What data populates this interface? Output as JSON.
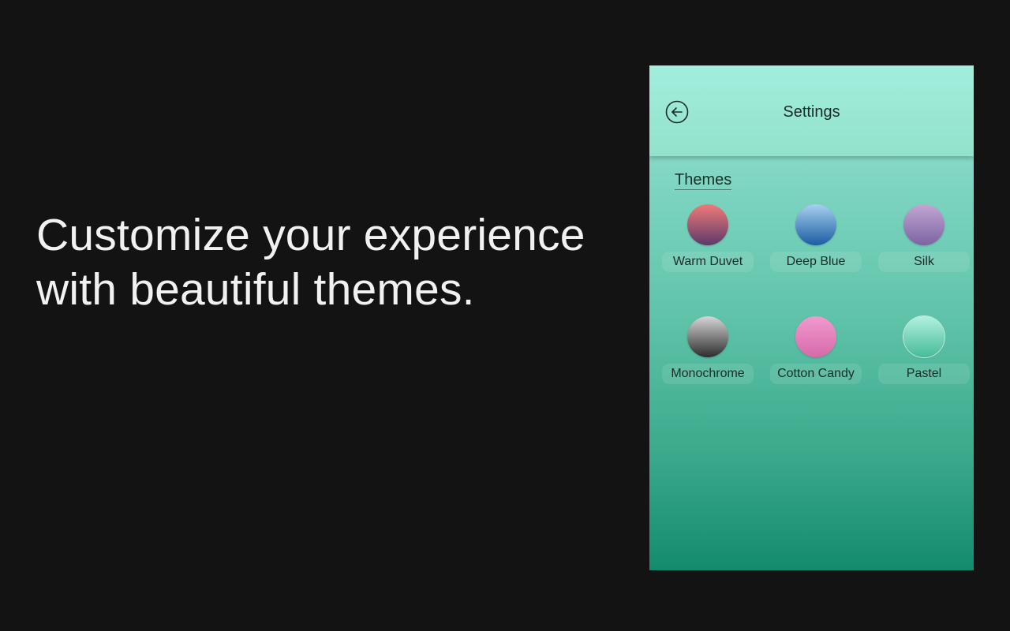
{
  "headline": {
    "line1": "Customize your experience",
    "line2": "with beautiful themes."
  },
  "settings": {
    "title": "Settings",
    "back_icon": "back-arrow-icon",
    "section_label": "Themes",
    "themes": [
      {
        "label": "Warm Duvet",
        "gradient": [
          "#f07a78",
          "#5b3a6b"
        ]
      },
      {
        "label": "Deep Blue",
        "gradient": [
          "#a7d0ef",
          "#1b5ca2"
        ]
      },
      {
        "label": "Silk",
        "gradient": [
          "#c3a6d3",
          "#7c64a3"
        ]
      },
      {
        "label": "Monochrome",
        "gradient": [
          "#d6d6d6",
          "#2d2d2d"
        ]
      },
      {
        "label": "Cotton Candy",
        "gradient": [
          "#f19ad0",
          "#d66aa9"
        ]
      },
      {
        "label": "Pastel",
        "gradient": [
          "#b2f1df",
          "#46bb98"
        ]
      }
    ]
  },
  "colors": {
    "background": "#131313",
    "headline_text": "#f1f1f1",
    "panel_top": "#9fe9d9",
    "panel_bottom": "#148b6d"
  }
}
